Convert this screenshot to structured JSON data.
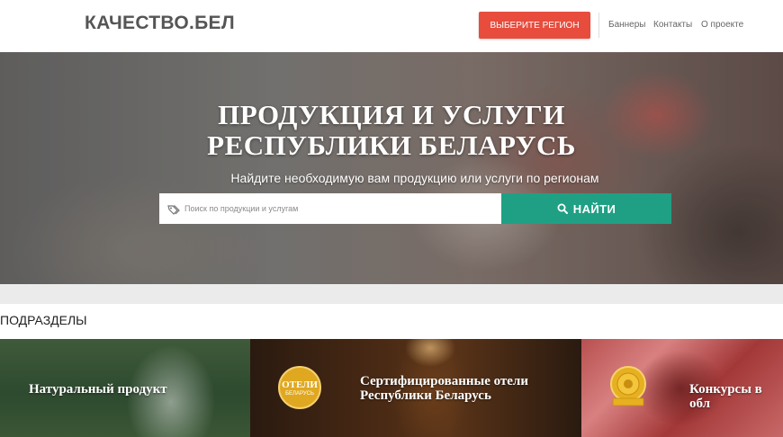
{
  "header": {
    "logo": "КАЧЕСТВО.БЕЛ",
    "region_button": "ВЫБЕРИТЕ РЕГИОН",
    "nav": [
      "Баннеры",
      "Контакты",
      "О проекте"
    ]
  },
  "hero": {
    "title_line1": "ПРОДУКЦИЯ И УСЛУГИ",
    "title_line2": "РЕСПУБЛИКИ БЕЛАРУСЬ",
    "subtitle": "Найдите необходимую вам продукцию или услуги по регионам",
    "search": {
      "placeholder": "Поиск по продукции и услугам",
      "value": ""
    },
    "find_button": "НАЙТИ"
  },
  "section": {
    "title": "ПОДРАЗДЕЛЫ"
  },
  "cards": [
    {
      "label": "Натуральный продукт"
    },
    {
      "label_line1": "Сертифицированные отели",
      "label_line2": "Республики Беларусь",
      "badge_text": "ОТЕЛИ",
      "badge_sub": "БЕЛАРУСЬ"
    },
    {
      "label": "Конкурсы в обл"
    }
  ],
  "colors": {
    "region_button": "#e84c3d",
    "find_button": "#1fa084",
    "logo": "#555555",
    "band": "#ebebeb"
  },
  "icons": {
    "search_field": "tags-icon",
    "find_button": "search-icon"
  }
}
